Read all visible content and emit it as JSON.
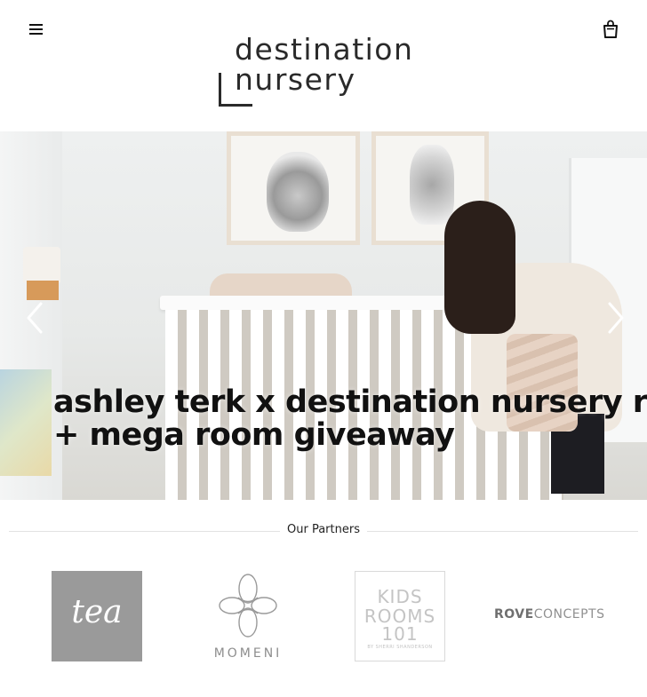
{
  "header": {
    "menu_icon": "hamburger-icon",
    "cart_icon": "shopping-bag-icon",
    "logo": {
      "line1": "destination",
      "line2": "nursery"
    }
  },
  "hero": {
    "title_line1": "ashley terk x destination nursery rev",
    "title_line2": "+ mega room giveaway",
    "prev_icon": "chevron-left-icon",
    "next_icon": "chevron-right-icon"
  },
  "partners": {
    "heading": "Our Partners",
    "items": [
      {
        "name": "tea",
        "label": "tea"
      },
      {
        "name": "momeni",
        "label": "MOMENI"
      },
      {
        "name": "kids-rooms-101",
        "label_line1": "KIDS",
        "label_line2": "ROOMS",
        "label_line3": "101",
        "tagline": "BY SHERRI SHANDERSON"
      },
      {
        "name": "rove-concepts",
        "label_bold": "ROVE",
        "label_rest": "CONCEPTS"
      }
    ]
  },
  "colors": {
    "text": "#111111",
    "tea_bg": "#9a9a9a",
    "muted": "#909090",
    "rule": "#e2e2e2"
  }
}
